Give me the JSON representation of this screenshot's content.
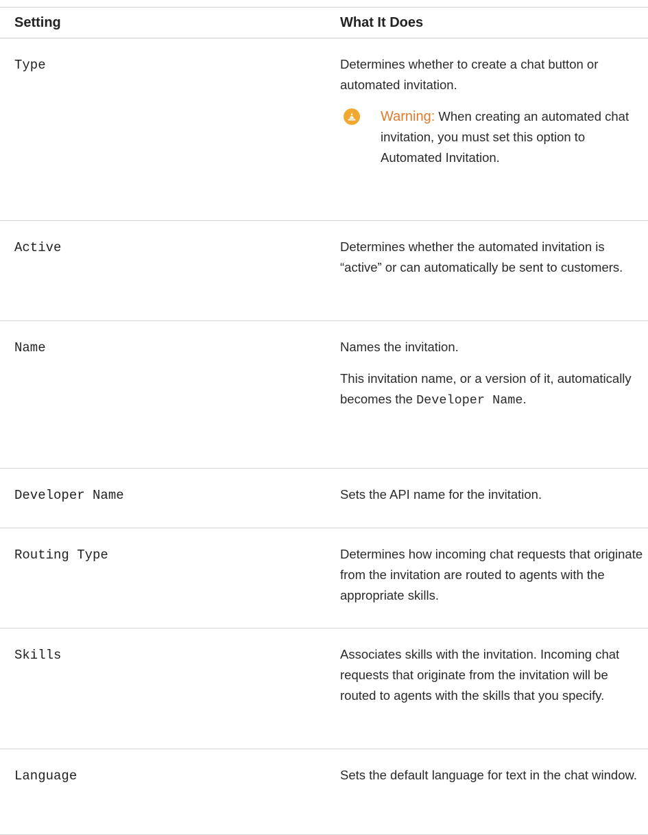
{
  "table": {
    "headers": {
      "setting": "Setting",
      "what_it_does": "What It Does"
    },
    "rows": [
      {
        "setting": "Type",
        "description": "Determines whether to create a chat button or automated invitation.",
        "warning": {
          "label": "Warning:",
          "text": " When creating an automated chat invitation, you must set this option to Automated Invitation."
        }
      },
      {
        "setting": "Active",
        "description": "Determines whether the automated invitation is “active” or can automatically be sent to customers."
      },
      {
        "setting": "Name",
        "description": "Names the invitation.",
        "extra_prefix": "This invitation name, or a version of it, automatically becomes the ",
        "extra_code": "Developer Name",
        "extra_suffix": "."
      },
      {
        "setting": "Developer Name",
        "description": "Sets the API name for the invitation."
      },
      {
        "setting": "Routing Type",
        "description": "Determines how incoming chat requests that originate from the invitation are routed to agents with the appropriate skills."
      },
      {
        "setting": "Skills",
        "description": "Associates skills with the invitation. Incoming chat requests that originate from the invitation will be routed to agents with the skills that you specify."
      },
      {
        "setting": "Language",
        "description": "Sets the default language for text in the chat window."
      }
    ]
  },
  "icons": {
    "warning_icon": "warning-cone-icon",
    "warning_icon_color": "#f0a830",
    "warning_label_color": "#e07a2a"
  }
}
